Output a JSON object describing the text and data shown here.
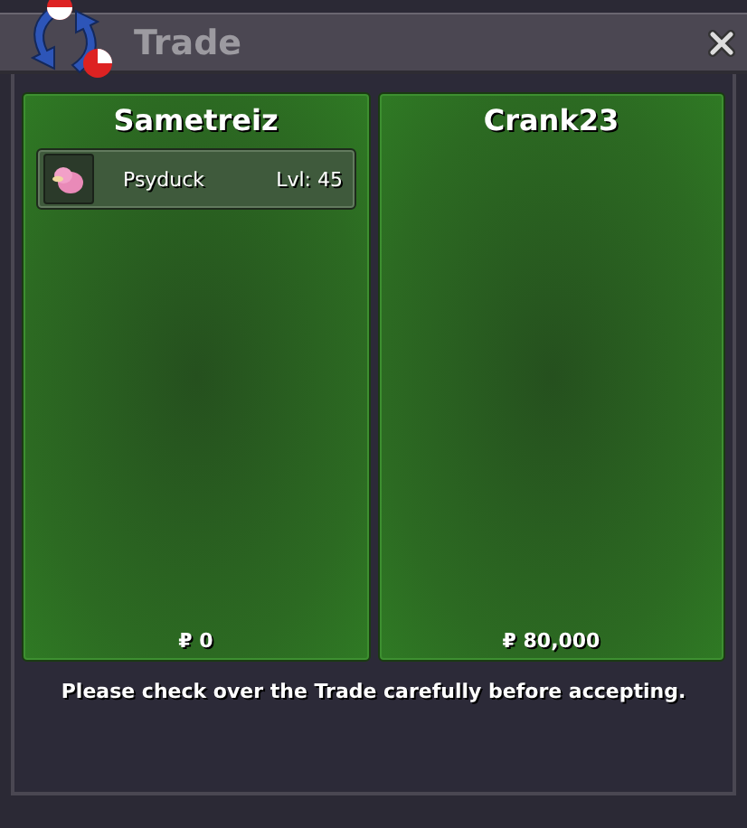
{
  "window": {
    "title": "Trade"
  },
  "trainers": [
    {
      "name": "Sametreiz",
      "pokemon": [
        {
          "name": "Psyduck",
          "level": "Lvl: 45"
        }
      ],
      "money": "₽ 0"
    },
    {
      "name": "Crank23",
      "money": "₽ 80,000"
    }
  ],
  "note": "Please check over the Trade carefully before accepting."
}
